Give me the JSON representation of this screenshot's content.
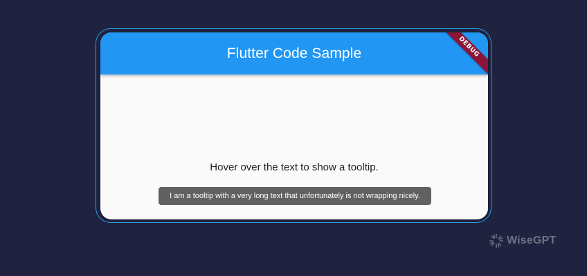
{
  "app": {
    "title": "Flutter Code Sample",
    "debug_label": "DEBUG"
  },
  "content": {
    "hover_text": "Hover over the text to show a tooltip.",
    "tooltip_text": "I am a tooltip with a very long text that unfortunately is not wrapping nicely."
  },
  "brand": {
    "name": "WiseGPT",
    "icon": "wisegpt-logo-icon"
  },
  "colors": {
    "background": "#1f2340",
    "frame_border": "#2e9ee6",
    "app_bar": "#2196f3",
    "debug_banner": "#8a1538",
    "tooltip": "#616161",
    "body": "#fafafa"
  }
}
